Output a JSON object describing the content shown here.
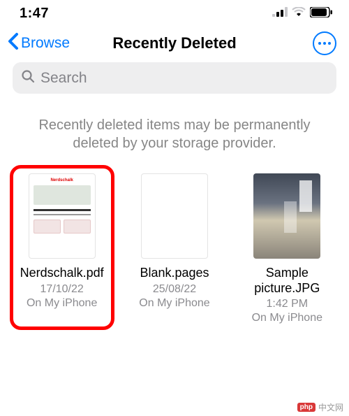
{
  "status": {
    "time": "1:47"
  },
  "nav": {
    "back_label": "Browse",
    "title": "Recently Deleted"
  },
  "search": {
    "placeholder": "Search"
  },
  "info_message": "Recently deleted items may be permanently deleted by your storage provider.",
  "files": [
    {
      "name": "Nerdschalk.pdf",
      "date": "17/10/22",
      "location": "On My iPhone"
    },
    {
      "name": "Blank.pages",
      "date": "25/08/22",
      "location": "On My iPhone"
    },
    {
      "name": "Sample picture.JPG",
      "date": "1:42 PM",
      "location": "On My iPhone"
    }
  ],
  "watermark": {
    "logo": "php",
    "text": "中文网"
  }
}
